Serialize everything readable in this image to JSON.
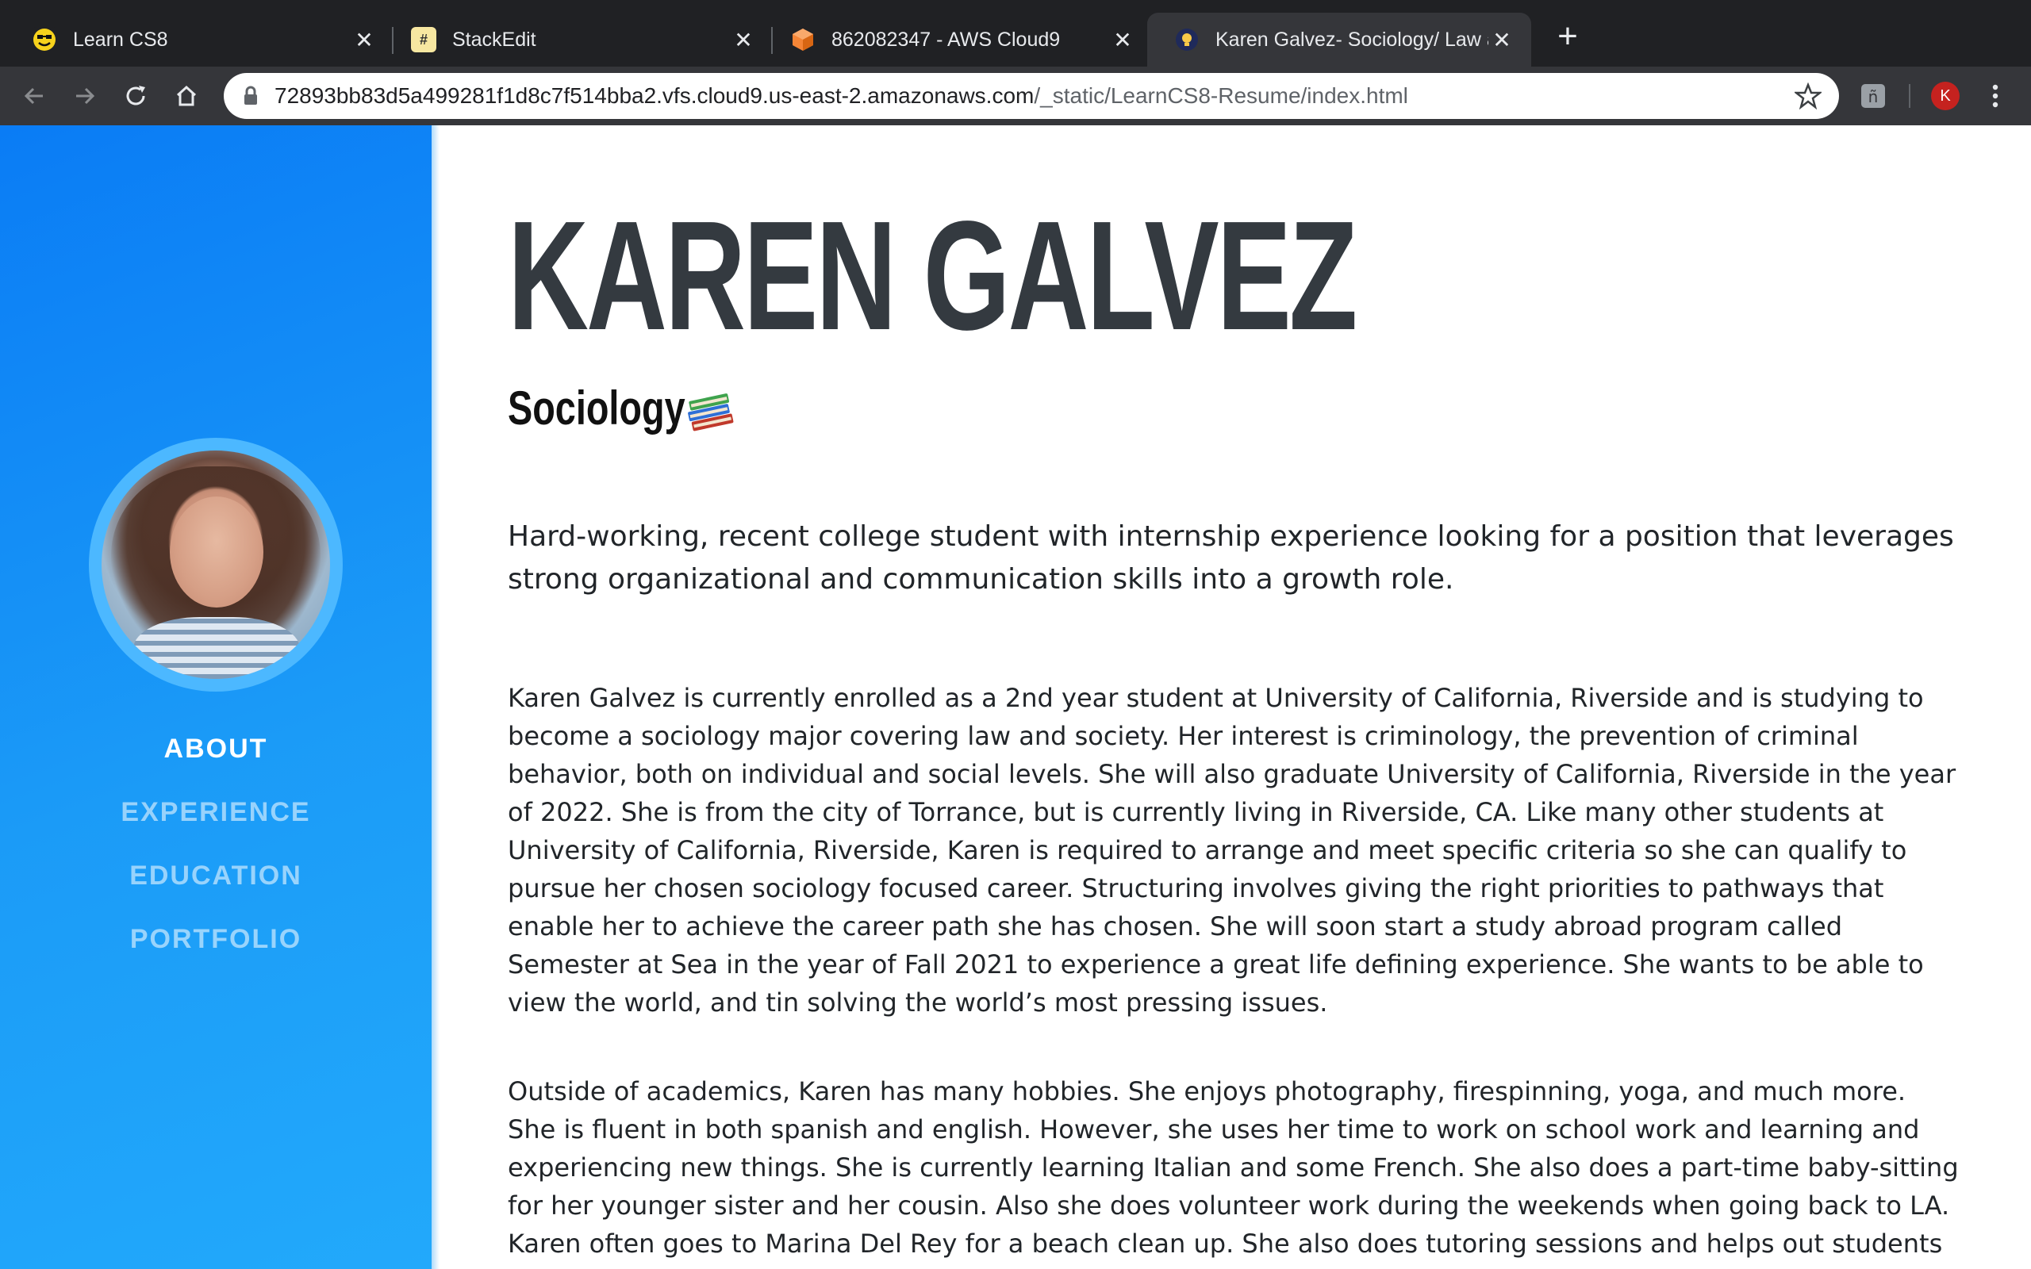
{
  "browser": {
    "tabs": [
      {
        "title": "Learn CS8",
        "favicon": "smiley-face-icon",
        "active": false
      },
      {
        "title": "StackEdit",
        "favicon": "hash-icon",
        "active": false
      },
      {
        "title": "862082347 - AWS Cloud9",
        "favicon": "cube-icon",
        "active": false
      },
      {
        "title": "Karen Galvez- Sociology/ Law a",
        "favicon": "bulb-icon",
        "active": true
      }
    ],
    "new_tab_label": "+",
    "url_host": "72893bb83d5a499281f1d8c7f514bba2.vfs.cloud9.us-east-2.amazonaws.com",
    "url_path": "/_static/LearnCS8-Resume/index.html",
    "profile_initial": "K"
  },
  "sidebar": {
    "nav": [
      {
        "label": "ABOUT",
        "active": true
      },
      {
        "label": "EXPERIENCE",
        "active": false
      },
      {
        "label": "EDUCATION",
        "active": false
      },
      {
        "label": "PORTFOLIO",
        "active": false
      }
    ]
  },
  "about": {
    "name": "KAREN GALVEZ",
    "subheading": "Sociology",
    "subheading_icon": "books-icon",
    "lead": "Hard-working, recent college student with internship experience looking for a position that leverages strong organizational and communication skills into a growth role.",
    "paragraphs": [
      "Karen Galvez is currently enrolled as a 2nd year student at University of California, Riverside and is studying to become a sociology major covering law and society. Her interest is criminology, the prevention of criminal behavior, both on individual and social levels. She will also graduate University of California, Riverside in the year of 2022. She is from the city of Torrance, but is currently living in Riverside, CA. Like many other students at University of California, Riverside, Karen is required to arrange and meet specific criteria so she can qualify to pursue her chosen sociology focused career. Structuring involves giving the right priorities to pathways that enable her to achieve the career path she has chosen. She will soon start a study abroad program called Semester at Sea in the year of Fall 2021 to experience a great life defining experience. She wants to be able to view the world, and tin solving the world’s most pressing issues.",
      "Outside of academics, Karen has many hobbies. She enjoys photography, firespinning, yoga, and much more. She is fluent in both spanish and english. However, she uses her time to work on school work and learning and experiencing new things. She is currently learning Italian and some French. She also does a part-time baby-sitting for her younger sister and her cousin. Also she does volunteer work during the weekends when going back to LA. Karen often goes to Marina Del Rey for a beach clean up. She also does tutoring sessions and helps out students with their homework when students get stuck. She"
    ]
  },
  "colors": {
    "sidebar_start": "#0a7cf5",
    "sidebar_end": "#22a9fb",
    "heading": "#343a40",
    "chrome_dark": "#202124",
    "chrome_toolbar": "#35363a"
  }
}
